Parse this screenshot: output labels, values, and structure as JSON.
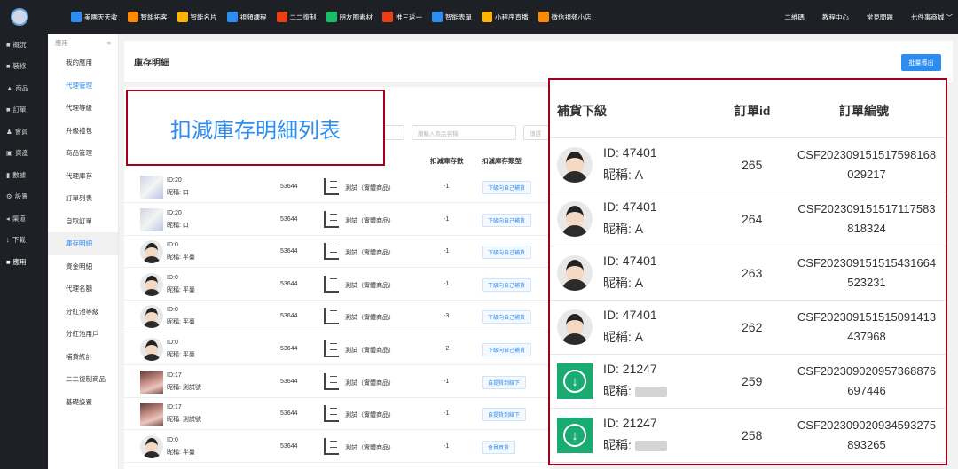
{
  "topbar": {
    "items": [
      {
        "label": "美團天天收",
        "color": "#2d8cf0"
      },
      {
        "label": "智能拓客",
        "color": "#ff8a00"
      },
      {
        "label": "智能名片",
        "color": "#ffb400"
      },
      {
        "label": "視頻課程",
        "color": "#2d8cf0"
      },
      {
        "label": "二二復制",
        "color": "#ed3f14"
      },
      {
        "label": "朋友圈素材",
        "color": "#19be6b"
      },
      {
        "label": "推三返一",
        "color": "#ed3f14"
      },
      {
        "label": "智能表單",
        "color": "#2d8cf0"
      },
      {
        "label": "小程序直播",
        "color": "#ffb400"
      },
      {
        "label": "微信視頻小店",
        "color": "#ff8a00"
      }
    ],
    "right": [
      "二維碼",
      "教程中心",
      "常見問題",
      "七件事商城 ﹀"
    ]
  },
  "leftnav": [
    {
      "label": "概況",
      "icon": "■"
    },
    {
      "label": "裝修",
      "icon": "■"
    },
    {
      "label": "商品",
      "icon": "▲"
    },
    {
      "label": "訂單",
      "icon": "■"
    },
    {
      "label": "會員",
      "icon": "♟"
    },
    {
      "label": "資產",
      "icon": "▣"
    },
    {
      "label": "數據",
      "icon": "▮"
    },
    {
      "label": "設置",
      "icon": "⚙"
    },
    {
      "label": "渠道",
      "icon": "◂"
    },
    {
      "label": "下載",
      "icon": "↓"
    },
    {
      "label": "應用",
      "icon": "■"
    }
  ],
  "subnav": {
    "header": "應用",
    "collapse": "≡",
    "items": [
      "我的應用",
      "代理管理",
      "代理等級",
      "升級禮包",
      "商品管理",
      "代理庫存",
      "訂單列表",
      "自取訂單",
      "庫存明細",
      "資金明細",
      "代理名額",
      "分紅池等級",
      "分紅池用戶",
      "補貨統計",
      "二二復制商品",
      "基礎設置"
    ]
  },
  "page": {
    "title": "庫存明細",
    "export_label": "批量導出",
    "annotation": "扣減庫存明細列表",
    "filter_left_placeholder": "",
    "filter_product_placeholder": "請輸入商品名稱",
    "filter_right_placeholder": "請選"
  },
  "table": {
    "headers": {
      "qty": "扣減庫存數",
      "type": "扣減庫存類型"
    },
    "rows": [
      {
        "id": "ID:20",
        "nick": "昵稱: 口",
        "avatar": "map",
        "num": "53644",
        "product": "測試（實體商品）",
        "qty": "-1",
        "type": "下級向自己補貨"
      },
      {
        "id": "ID:20",
        "nick": "昵稱: 口",
        "avatar": "map",
        "num": "53644",
        "product": "測試（實體商品）",
        "qty": "-1",
        "type": "下級向自己補貨"
      },
      {
        "id": "ID:0",
        "nick": "昵稱: 平臺",
        "avatar": "user",
        "num": "53644",
        "product": "測試（實體商品）",
        "qty": "-1",
        "type": "下級向自己補貨"
      },
      {
        "id": "ID:0",
        "nick": "昵稱: 平臺",
        "avatar": "user",
        "num": "53644",
        "product": "測試（實體商品）",
        "qty": "-1",
        "type": "下級向自己補貨"
      },
      {
        "id": "ID:0",
        "nick": "昵稱: 平臺",
        "avatar": "user",
        "num": "53644",
        "product": "測試（實體商品）",
        "qty": "-3",
        "type": "下級向自己補貨"
      },
      {
        "id": "ID:0",
        "nick": "昵稱: 平臺",
        "avatar": "user",
        "num": "53644",
        "product": "測試（實體商品）",
        "qty": "-2",
        "type": "下級向自己補貨"
      },
      {
        "id": "ID:17",
        "nick": "昵稱: 測試號",
        "avatar": "photo",
        "num": "53644",
        "product": "測試（實體商品）",
        "qty": "-1",
        "type": "自提貨到線下"
      },
      {
        "id": "ID:17",
        "nick": "昵稱: 測試號",
        "avatar": "photo",
        "num": "53644",
        "product": "測試（實體商品）",
        "qty": "-1",
        "type": "自提貨到線下"
      },
      {
        "id": "ID:0",
        "nick": "昵稱: 平臺",
        "avatar": "user",
        "num": "53644",
        "product": "測試（實體商品）",
        "qty": "-1",
        "type": "會員買貨"
      }
    ]
  },
  "right_panel": {
    "headers": {
      "sub": "補貨下級",
      "order_id": "訂單id",
      "order_no": "訂單編號"
    },
    "rows": [
      {
        "id": "ID: 47401",
        "nick": "昵稱: A",
        "avatar": "user",
        "order_id": "265",
        "order_no_1": "CSF202309151517598168",
        "order_no_2": "029217"
      },
      {
        "id": "ID: 47401",
        "nick": "昵稱: A",
        "avatar": "user",
        "order_id": "264",
        "order_no_1": "CSF202309151517117583",
        "order_no_2": "818324"
      },
      {
        "id": "ID: 47401",
        "nick": "昵稱: A",
        "avatar": "user",
        "order_id": "263",
        "order_no_1": "CSF202309151515431664",
        "order_no_2": "523231"
      },
      {
        "id": "ID: 47401",
        "nick": "昵稱: A",
        "avatar": "user",
        "order_id": "262",
        "order_no_1": "CSF202309151515091413",
        "order_no_2": "437968"
      },
      {
        "id": "ID: 21247",
        "nick": "昵稱:",
        "avatar": "green",
        "order_id": "259",
        "order_no_1": "CSF202309020957368876",
        "order_no_2": "697446"
      },
      {
        "id": "ID: 21247",
        "nick": "昵稱:",
        "avatar": "green",
        "order_id": "258",
        "order_no_1": "CSF202309020934593275",
        "order_no_2": "893265"
      }
    ]
  }
}
